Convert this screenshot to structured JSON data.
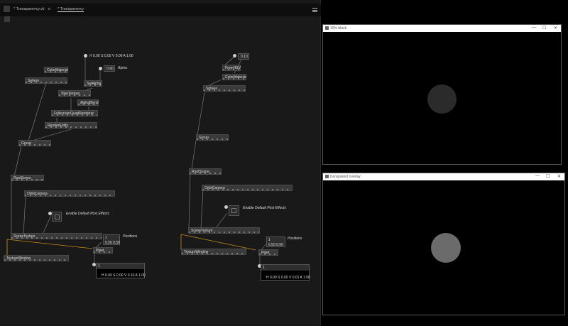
{
  "editor": {
    "tab_file": "* Transparency.vl",
    "tab_patch": "* Transparency",
    "nav_back": "◀",
    "nav_forward": "▶",
    "nav_sep": "-",
    "menu_icon": "hamburger-menu-icon"
  },
  "patch_left": {
    "color_iobox": "H 0.00 S 0.00 V 0.00 A 1.00",
    "alpha_value": "0.90",
    "alpha_label": "Alpha",
    "nodes": {
      "color_material": "ColorMaterial",
      "sphere": "Sphere",
      "set_alpha": "SetAlpha",
      "skia_texture": "SkiaTexture",
      "alpha_blend": "AlphaBlend",
      "fullscreen_quad": "FullscreenQuadRenderer",
      "render_entity": "RenderEntity",
      "group": "Group",
      "root_scene": "RootScene",
      "orbit_camera": "OrbitCamera",
      "scene_texture": "SceneTexture",
      "pipet": "Pipet",
      "texture_window": "TextureWindow"
    },
    "post_effects_label": "Enable Default Post Effects",
    "positions_count": "1",
    "positions_value": "0.50   0.50",
    "positions_label": "Positions",
    "result_count": "1",
    "result_value": "H 0.00 S 0.00 V 0.10 A 1.00"
  },
  "patch_right": {
    "value_iobox": "0.10",
    "nodes": {
      "from_hsv": "FromHSV",
      "color_material": "ColorMaterial",
      "sphere": "Sphere",
      "group": "Group",
      "root_scene": "RootScene",
      "orbit_camera": "OrbitCamera",
      "scene_texture": "SceneTexture",
      "pipet": "Pipet",
      "texture_window": "TextureWindow"
    },
    "post_effects_label": "Enable Default Post Effects",
    "positions_count": "1",
    "positions_value": "0.50   0.50",
    "positions_label": "Positions",
    "result_count": "1",
    "result_value": "H 0.00 S 0.00 V 0.01 A 1.00"
  },
  "window_top": {
    "title": "10% black",
    "sphere_color": "#2b2b2b",
    "controls": [
      "—",
      "☐",
      "✕"
    ]
  },
  "window_bottom": {
    "title": "transparent overlay",
    "sphere_color": "#6b6b6b",
    "controls": [
      "—",
      "☐",
      "✕"
    ]
  }
}
